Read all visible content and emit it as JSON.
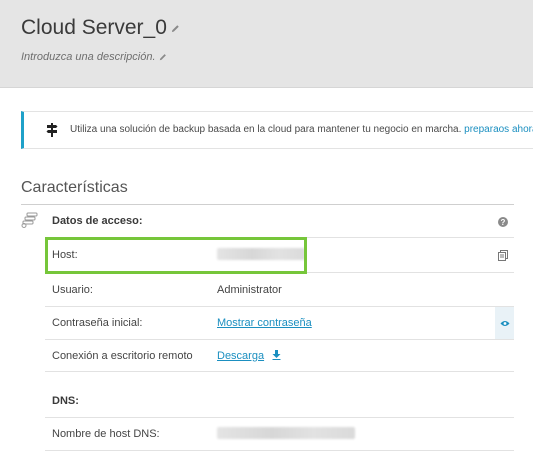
{
  "header": {
    "title": "Cloud Server_0",
    "description": "Introduzca una descripción."
  },
  "banner": {
    "message": "Utiliza una solución de backup basada en la cloud para mantener tu negocio en marcha.",
    "link": "preparaos ahora"
  },
  "section": {
    "title": "Características"
  },
  "access": {
    "heading": "Datos de acceso:",
    "host_label": "Host:",
    "user_label": "Usuario:",
    "user_value": "Administrator",
    "password_label": "Contraseña inicial:",
    "password_link": "Mostrar contraseña",
    "rdp_label": "Conexión a escritorio remoto",
    "rdp_link": "Descarga"
  },
  "dns": {
    "heading": "DNS:",
    "hostname_label": "Nombre de host DNS:"
  },
  "colors": {
    "accent_link": "#1b8fc0",
    "banner_border": "#1fa1c9",
    "highlight_box": "#76c63a",
    "header_bg": "#e5e5e5"
  },
  "icons": [
    "pencil-icon",
    "flag-icon",
    "server-icon",
    "help-icon",
    "copy-icon",
    "eye-icon",
    "download-icon"
  ]
}
